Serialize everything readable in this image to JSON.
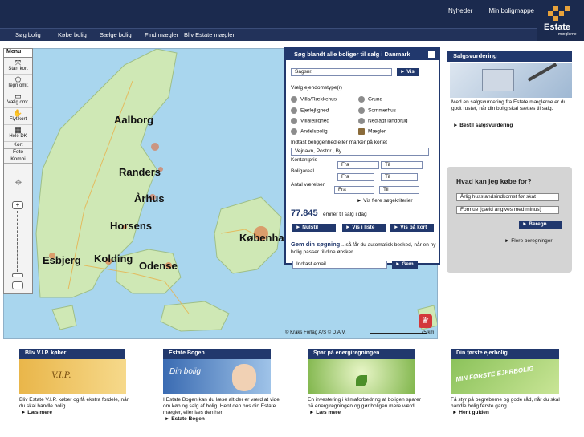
{
  "header": {
    "links": [
      "Nyheder",
      "Min boligmappe"
    ],
    "logo_text": [
      "Estate",
      "mæglerne"
    ]
  },
  "nav": [
    "Søg bolig",
    "Købe bolig",
    "Sælge bolig",
    "Find mægler",
    "Bliv Estate mægler"
  ],
  "map": {
    "toolbar": {
      "title": "Menu",
      "tools": [
        "Start kort",
        "Tegn omr.",
        "Vælg omr.",
        "Flyt kort",
        "Hele DK"
      ],
      "tabs": [
        "Kort",
        "Foto",
        "Kombi"
      ]
    },
    "cities": [
      "Aalborg",
      "Randers",
      "Århus",
      "Horsens",
      "Esbjerg",
      "Kolding",
      "Odense",
      "København"
    ],
    "copyright": "© Kraks Forlag A/S © D.A.V.",
    "scale": "75 km"
  },
  "search": {
    "title": "Søg blandt alle boliger til salg i Danmark",
    "case_placeholder": "Sagsnr.",
    "go_button": "Vis",
    "type_label": "Vælg ejendomstype(r)",
    "types": [
      {
        "badge": "V",
        "label": "Villa/Rækkehus"
      },
      {
        "badge": "G",
        "label": "Grund"
      },
      {
        "badge": "E",
        "label": "Ejerlejlighed"
      },
      {
        "badge": "S",
        "label": "Sommerhus"
      },
      {
        "badge": "VL",
        "label": "Villalejlighed"
      },
      {
        "badge": "N",
        "label": "Nedlagt landbrug"
      },
      {
        "badge": "A",
        "label": "Andelsbolig"
      },
      {
        "badge": "M",
        "label": "Mægler"
      }
    ],
    "location_label": "Indtast beliggenhed eller markér på kortet",
    "location_placeholder": "Vejnavn, Postnr., By",
    "ranges": [
      {
        "label": "Kontantpris",
        "from": "Fra",
        "to": "Til"
      },
      {
        "label": "Boligareal",
        "from": "Fra",
        "to": "Til"
      },
      {
        "label": "Antal værelser",
        "from": "Fra",
        "to": "Til"
      }
    ],
    "more_criteria": "Vis flere søgekriterier",
    "count": "77.845",
    "count_suffix": "emner til salg i dag",
    "buttons": [
      "Nulstil",
      "Vis i liste",
      "Vis på kort"
    ],
    "save_title": "Gem din søgning",
    "save_text": "...så får du automatisk besked, når en ny bolig passer til dine ønsker.",
    "email_placeholder": "Indtast email",
    "save_button": "Gem"
  },
  "valuation": {
    "title": "Salgsvurdering",
    "text": "Med en salgsvurdering fra Estate mæglerne er du godt rustet, når din bolig skal sættes til salg.",
    "link": "Bestil salgsvurdering"
  },
  "calc": {
    "title": "Hvad kan jeg købe for?",
    "field1": "Årlig husstandsindkomst før skat",
    "field2": "Formue (gæld angives med minus)",
    "button": "Beregn",
    "link": "Flere beregninger"
  },
  "cards": [
    {
      "title": "Bliv V.I.P. køber",
      "image_text": "V.I.P.",
      "text": "Bliv Estate V.I.P. køber og få ekstra fordele, når du skal handle bolig",
      "link": "Læs mere"
    },
    {
      "title": "Estate Bogen",
      "image_text": "Din bolig",
      "text": "I Estate Bogen kan du læse alt der er værd at vide om køb og salg af bolig. Hent den hos din Estate mægler, eller læs den her.",
      "link": "Estate Bogen"
    },
    {
      "title": "Spar på energiregningen",
      "image_text": "",
      "text": "En investering i klimaforbedring af boligen sparer på energiregningen og gør boligen mere værd.",
      "link": "Læs mere"
    },
    {
      "title": "Din første ejerbolig",
      "image_text": "MIN FØRSTE EJERBOLIG",
      "text": "Få styr på begreberne og gode råd, når du skal handle bolig første gang.",
      "link": "Hent guiden"
    }
  ],
  "colors": {
    "navy": "#1b2a4e",
    "panel": "#21386d",
    "sea": "#a9d6ee",
    "land": "#cfe8b5"
  }
}
